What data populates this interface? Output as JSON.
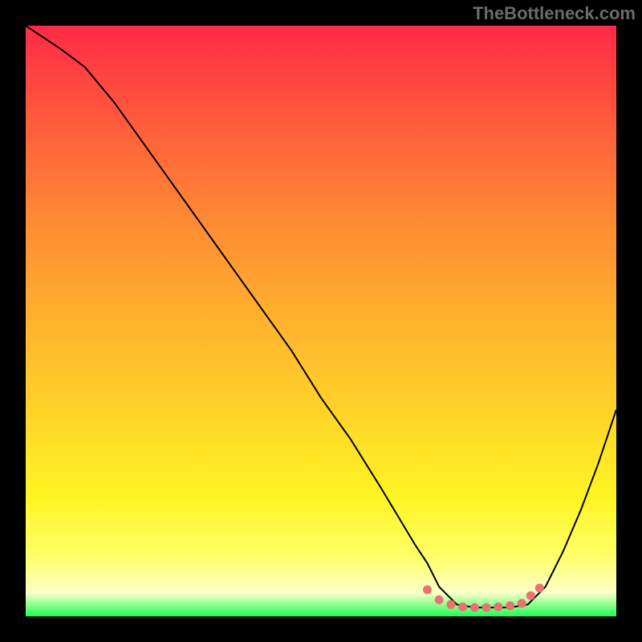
{
  "watermark": "TheBottleneck.com",
  "colors": {
    "background_black": "#000000",
    "curve_stroke": "#000000",
    "marker_fill": "#e97272",
    "gradient_stops": [
      {
        "offset": "0%",
        "color": "#ff2a47"
      },
      {
        "offset": "16%",
        "color": "#ff5a3c"
      },
      {
        "offset": "33%",
        "color": "#ff8a34"
      },
      {
        "offset": "50%",
        "color": "#ffb22e"
      },
      {
        "offset": "66%",
        "color": "#ffd528"
      },
      {
        "offset": "80%",
        "color": "#fff523"
      },
      {
        "offset": "90%",
        "color": "#ffff6a"
      },
      {
        "offset": "96%",
        "color": "#fdffc8"
      },
      {
        "offset": "100%",
        "color": "#21ff56"
      }
    ]
  },
  "chart_data": {
    "type": "line",
    "title": "",
    "xlabel": "",
    "ylabel": "",
    "xlim": [
      0,
      100
    ],
    "ylim": [
      0,
      100
    ],
    "grid": false,
    "legend": false,
    "annotations": [
      "TheBottleneck.com"
    ],
    "series": [
      {
        "name": "bottleneck-curve",
        "x": [
          0,
          3,
          6,
          10,
          15,
          20,
          25,
          30,
          35,
          40,
          45,
          50,
          55,
          60,
          63,
          66,
          68,
          70,
          73,
          76,
          79,
          82,
          85,
          88,
          91,
          94,
          97,
          100
        ],
        "y": [
          100,
          98,
          96,
          93,
          87,
          80,
          73,
          66,
          59,
          52,
          45,
          37,
          30,
          22,
          17,
          12,
          9,
          5,
          2,
          1.5,
          1.5,
          1.5,
          2,
          5,
          11,
          18,
          26,
          35
        ]
      }
    ],
    "markers": {
      "name": "valley-dots",
      "x": [
        68,
        70,
        72,
        74,
        76,
        78,
        80,
        82,
        84,
        85.5,
        87
      ],
      "y": [
        4.5,
        2.8,
        2.0,
        1.6,
        1.5,
        1.5,
        1.6,
        1.8,
        2.2,
        3.5,
        4.8
      ]
    }
  }
}
